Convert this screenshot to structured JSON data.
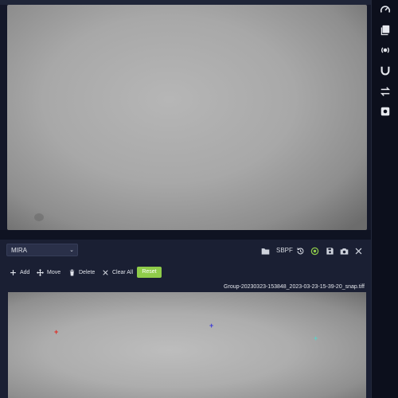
{
  "right_sidebar": {
    "icons": [
      "gauge-icon",
      "library-icon",
      "broadcast-icon",
      "magnet-icon",
      "swap-icon",
      "settings-square-icon"
    ]
  },
  "panel": {
    "select": {
      "value": "MIRA"
    },
    "toolbar": {
      "sbpf_label": "SBPF",
      "icons": [
        "folder-icon",
        "history-icon",
        "target-icon",
        "save-icon",
        "camera-icon",
        "close-icon"
      ],
      "accent_color": "#8fcc4a"
    },
    "tools": {
      "add_label": "Add",
      "move_label": "Move",
      "delete_label": "Delete",
      "clear_all_label": "Clear All",
      "reset_label": "Reset"
    },
    "filename": "Group-20230323-153848_2023-03-23-15-39-20_snap.tiff",
    "markers": [
      {
        "symbol": "+",
        "color": "#e0281f"
      },
      {
        "symbol": "+",
        "color": "#3d3ad6"
      },
      {
        "symbol": "+",
        "color": "#5fd0c7"
      }
    ]
  }
}
